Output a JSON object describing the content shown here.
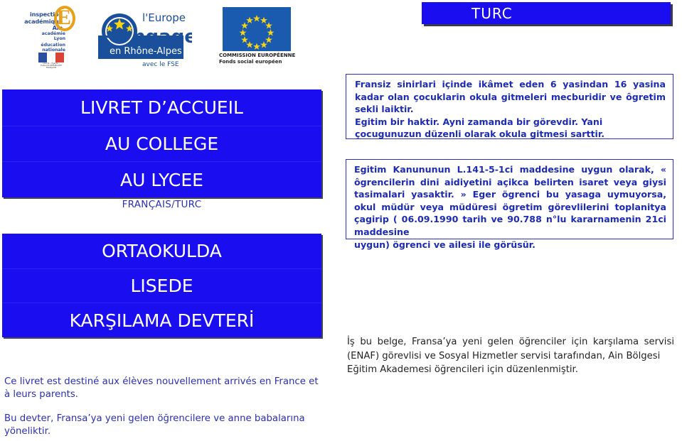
{
  "header": {
    "logos": {
      "inspection_academique": {
        "name": "inspection-academique-ain-logo",
        "wordmark_line1": "inspection académique",
        "wordmark_line2": "Ain",
        "letter": "É",
        "sub_line1": "académie",
        "sub_line2": "Lyon",
        "sub2_line1": "éducation",
        "sub2_line2": "nationale",
        "marianne_caption": "Liberté • Égalité • Fraternité\nRÉPUBLIQUE FRANÇAISE"
      },
      "europe_sengage": {
        "name": "leurope-sengage-rhone-alpes-logo",
        "line1": "l'Europe",
        "line2": "s'engage",
        "line3": "en Rhône-Alpes",
        "line4": "avec le FSE"
      },
      "commission_europeenne": {
        "name": "commission-europeenne-logo",
        "caption_line1": "COMMISSION EUROPÉENNE",
        "caption_line2": "Fonds social européen"
      }
    },
    "banner": {
      "label": "TURC"
    }
  },
  "left": {
    "french_block": [
      "LIVRET D’ACCUEIL",
      "AU COLLEGE",
      "AU LYCEE"
    ],
    "languages_label": "FRANÇAIS/TURC",
    "turkish_block": [
      "ORTAOKULDA",
      "LISEDE",
      "KARŞILAMA DEVTERİ"
    ],
    "note_fr": "Ce livret est destiné aux élèves nouvellement arrivés en France et à leurs parents.",
    "note_tr_main": "Bu devter, Fransa’ya yeni gelen öğrencilere ve anne babalarına",
    "note_tr_last": "yöneliktir."
  },
  "right": {
    "box_obligation": {
      "paragraph1": "Fransiz sinirlari içinde ikâmet eden 6 yasindan 16 yasina kadar olan çocuklarin okula gitmeleri mecburidir ve ôgretim sekli laiktir.",
      "paragraph2": "Egitim bir haktir. Ayni zamanda bir görevdir. Yani çocugunuzun düzenli olarak okula gitmesi sarttir."
    },
    "box_laicite": {
      "main": "Egitim Kanununun L.141-5-1ci maddesine uygun olarak, « ôgrencilerin dini aidiyetini açikca belirten isaret veya giysi tasimalari yasaktir. »  Eger ögrenci bu yasaga uymuyorsa, okul müdür veya müdüresi ögretim görevlilerini toplanitya çagirip ( 06.09.1990 tarih ve 90.788 n°lu kararnamenin 21ci maddesine",
      "last": "uygun)  ögrenci ve ailesi ile görüsür."
    },
    "enaf_note": {
      "main": "İş bu belge,  Fransa’ya yeni gelen öğrenciler için karşılama servisi (ENAF) görevlisi ve Sosyal Hizmetler servisi tarafından, Ain Bölgesi",
      "last": "Eğitim Akademesi öğrencileri için düzenlenmiştir."
    }
  },
  "colors": {
    "primary_blue": "#1a0ef0",
    "text_blue": "#2b2fb8",
    "eu_blue": "#1a5bb0",
    "gold": "#e8a01a",
    "black_text": "#231f20"
  }
}
